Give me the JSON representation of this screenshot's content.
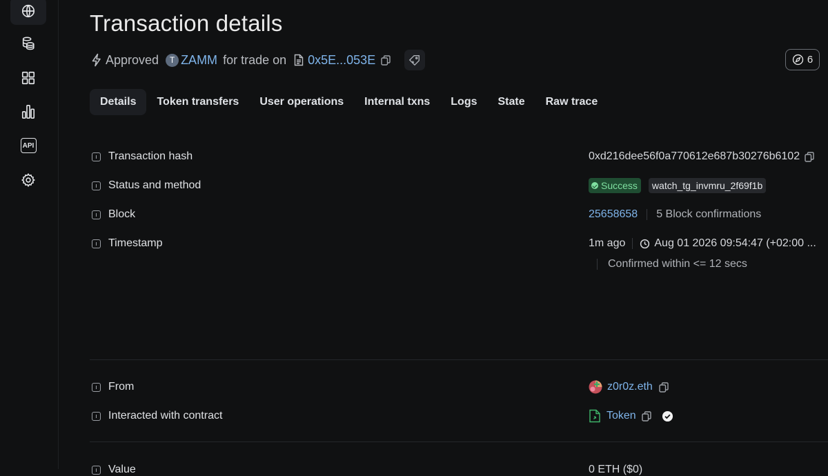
{
  "page": {
    "title": "Transaction details"
  },
  "subline": {
    "action": "Approved",
    "token_letter": "T",
    "token_name": "ZAMM",
    "connector": "for trade on",
    "address": "0x5E...053E"
  },
  "counter": {
    "value": "6"
  },
  "sidebar": {
    "items": [
      {
        "icon": "globe-icon"
      },
      {
        "icon": "coins-icon"
      },
      {
        "icon": "grid-icon"
      },
      {
        "icon": "bar-chart-icon"
      },
      {
        "icon": "api-icon",
        "label": "API"
      },
      {
        "icon": "gear-icon"
      }
    ]
  },
  "tabs": [
    "Details",
    "Token transfers",
    "User operations",
    "Internal txns",
    "Logs",
    "State",
    "Raw trace"
  ],
  "rows": {
    "hash": {
      "label": "Transaction hash",
      "value": "0xd216dee56f0a770612e687b30276b6102"
    },
    "status": {
      "label": "Status and method",
      "status": "Success",
      "method": "watch_tg_invmru_2f69f1b"
    },
    "block": {
      "label": "Block",
      "number": "25658658",
      "confirmations": "5 Block confirmations"
    },
    "timestamp": {
      "label": "Timestamp",
      "ago": "1m ago",
      "datetime": "Aug 01 2026 09:54:47 (+02:00 ...",
      "confirmed": "Confirmed within <= 12 secs"
    },
    "from": {
      "label": "From",
      "value": "z0r0z.eth"
    },
    "contract": {
      "label": "Interacted with contract",
      "value": "Token"
    },
    "value": {
      "label": "Value",
      "value": "0 ETH ($0)"
    }
  },
  "colors": {
    "link": "#7fb4ea",
    "success_bg": "#1f4d32",
    "success_text": "#7fe0a0",
    "background": "#101112"
  }
}
